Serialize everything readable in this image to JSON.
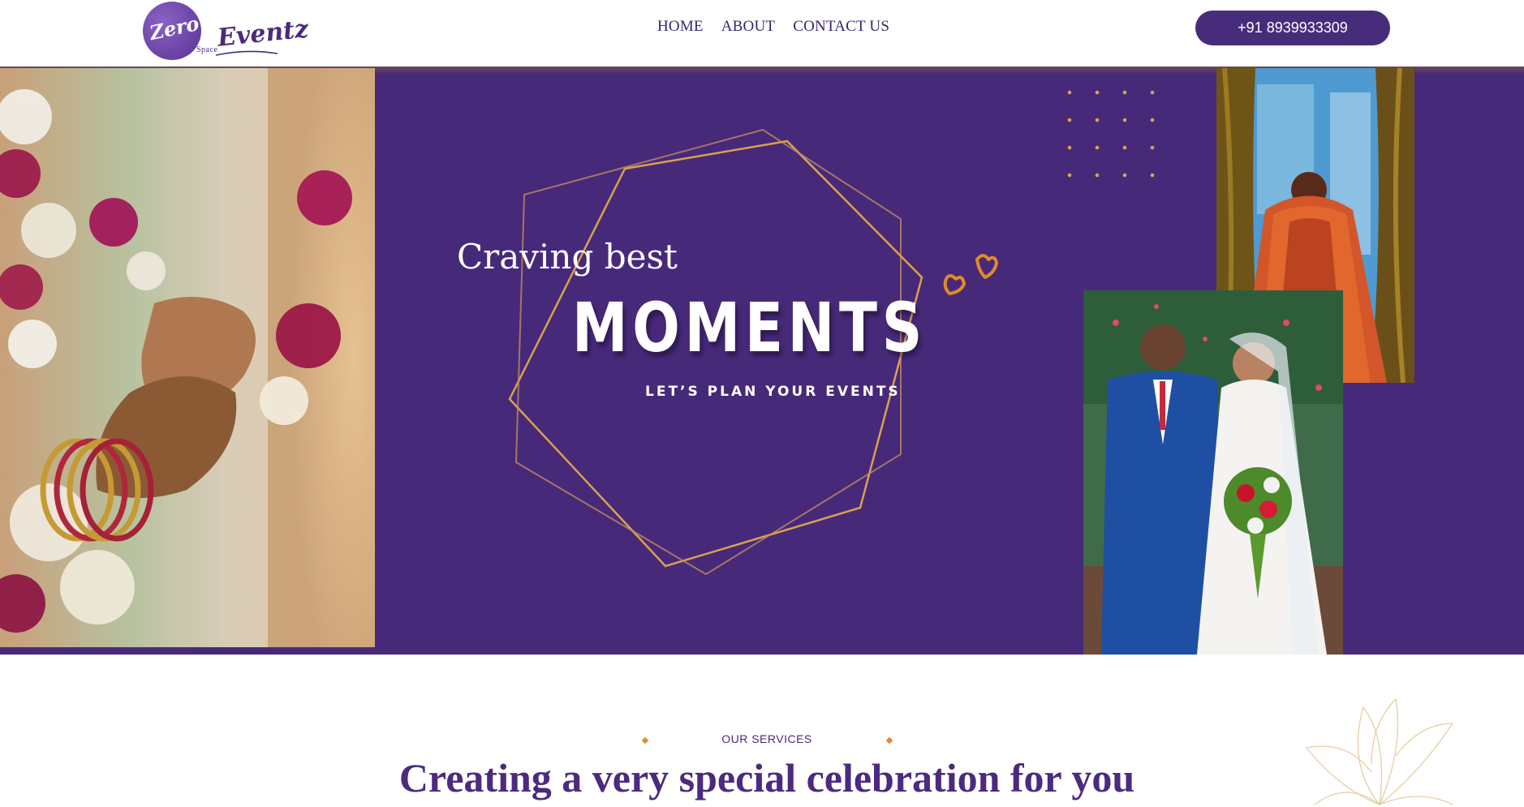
{
  "brand": {
    "logo_primary": "Zero",
    "logo_small": "Space",
    "logo_secondary": "Eventz",
    "color_purple": "#47297a",
    "color_gold": "#d9a548"
  },
  "nav": {
    "items": [
      {
        "label": "HOME"
      },
      {
        "label": "ABOUT"
      },
      {
        "label": "CONTACT US"
      }
    ],
    "phone_label": "+91 8939933309"
  },
  "hero": {
    "heading_small": "Craving best",
    "heading_large": "MOMENTS",
    "tagline": "LET’S  PLAN YOUR EVENTS"
  },
  "services": {
    "kicker": "OUR SERVICES",
    "title": "Creating a very special celebration for you"
  }
}
